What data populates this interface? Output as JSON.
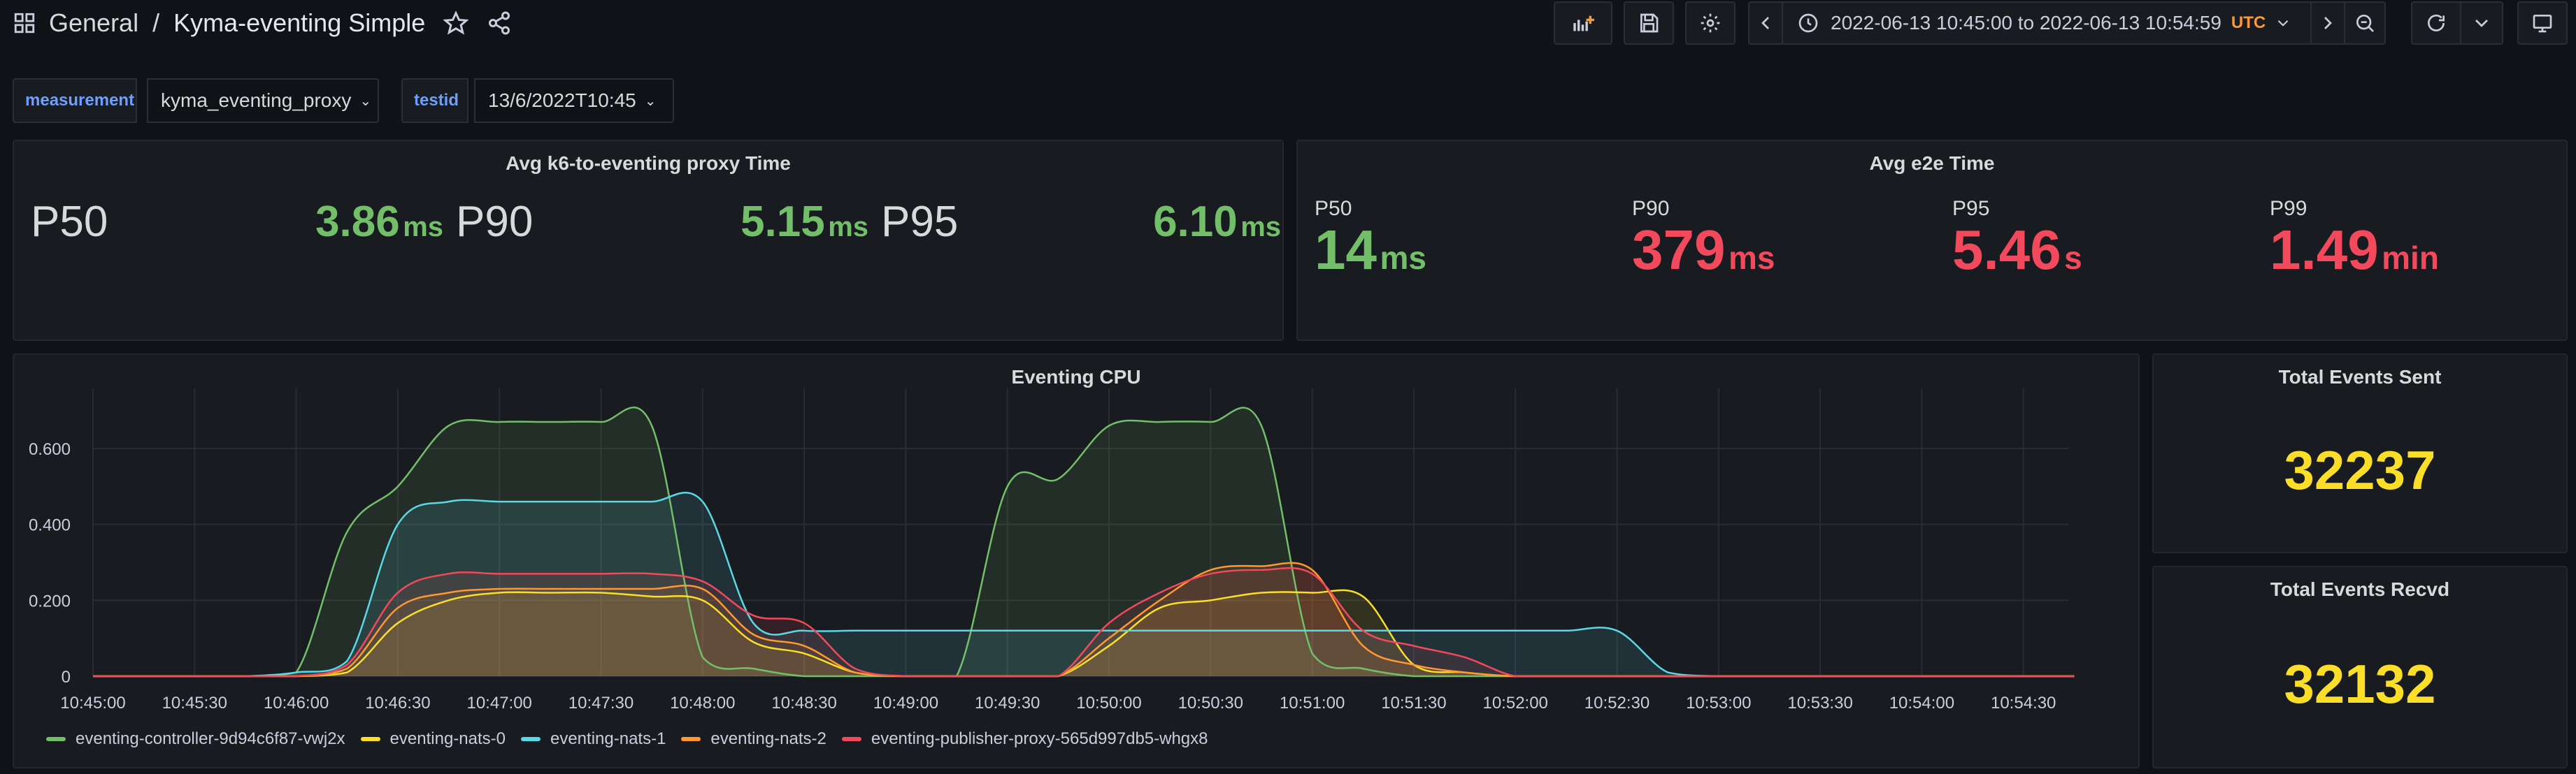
{
  "header": {
    "folder": "General",
    "separator": "/",
    "title": "Kyma-eventing Simple",
    "time_from": "2022-06-13 10:45:00",
    "time_to_word": "to",
    "time_to": "2022-06-13 10:54:59",
    "timezone": "UTC"
  },
  "variables": [
    {
      "label": "measurement",
      "value": "kyma_eventing_proxy"
    },
    {
      "label": "testid",
      "value": "13/6/2022T10:45"
    }
  ],
  "panels": {
    "proxy": {
      "title": "Avg k6-to-eventing proxy Time",
      "stats": [
        {
          "name": "P50",
          "value": "3.86",
          "unit": "ms"
        },
        {
          "name": "P90",
          "value": "5.15",
          "unit": "ms"
        },
        {
          "name": "P95",
          "value": "6.10",
          "unit": "ms"
        }
      ]
    },
    "e2e": {
      "title": "Avg e2e Time",
      "stats": [
        {
          "name": "P50",
          "value": "14",
          "unit": "ms",
          "color": "#73bf69"
        },
        {
          "name": "P90",
          "value": "379",
          "unit": "ms",
          "color": "#f2495c"
        },
        {
          "name": "P95",
          "value": "5.46",
          "unit": "s",
          "color": "#f2495c"
        },
        {
          "name": "P99",
          "value": "1.49",
          "unit": "min",
          "color": "#f2495c"
        }
      ]
    },
    "cpu": {
      "title": "Eventing CPU"
    },
    "sent": {
      "title": "Total Events Sent",
      "value": "32237"
    },
    "recvd": {
      "title": "Total Events Recvd",
      "value": "32132"
    }
  },
  "chart_data": {
    "type": "area",
    "title": "Eventing CPU",
    "x": [
      "10:45:00",
      "10:45:15",
      "10:45:30",
      "10:45:45",
      "10:46:00",
      "10:46:15",
      "10:46:30",
      "10:46:45",
      "10:47:00",
      "10:47:15",
      "10:47:30",
      "10:47:45",
      "10:48:00",
      "10:48:15",
      "10:48:30",
      "10:48:45",
      "10:49:00",
      "10:49:15",
      "10:49:30",
      "10:49:45",
      "10:50:00",
      "10:50:15",
      "10:50:30",
      "10:50:45",
      "10:51:00",
      "10:51:15",
      "10:51:30",
      "10:51:45",
      "10:52:00",
      "10:52:15",
      "10:52:30",
      "10:52:45",
      "10:53:00",
      "10:53:15",
      "10:53:30",
      "10:53:45",
      "10:54:00",
      "10:54:15",
      "10:54:30",
      "10:54:45"
    ],
    "x_ticks": [
      "10:45:00",
      "10:45:30",
      "10:46:00",
      "10:46:30",
      "10:47:00",
      "10:47:30",
      "10:48:00",
      "10:48:30",
      "10:49:00",
      "10:49:30",
      "10:50:00",
      "10:50:30",
      "10:51:00",
      "10:51:30",
      "10:52:00",
      "10:52:30",
      "10:53:00",
      "10:53:30",
      "10:54:00",
      "10:54:30"
    ],
    "y_ticks": [
      "0",
      "0.200",
      "0.400",
      "0.600"
    ],
    "ylim": [
      0,
      0.74
    ],
    "grid": true,
    "legend_position": "bottom-left",
    "series": [
      {
        "name": "eventing-controller-9d94c6f87-vwj2x",
        "color": "#73bf69",
        "values": [
          0,
          0,
          0,
          0,
          0.01,
          0.38,
          0.5,
          0.66,
          0.67,
          0.67,
          0.67,
          0.66,
          0.05,
          0.02,
          0,
          0,
          0,
          0,
          0.5,
          0.52,
          0.66,
          0.67,
          0.67,
          0.66,
          0.06,
          0.02,
          0,
          0,
          0,
          0,
          0,
          0,
          0,
          0,
          0,
          0,
          0,
          0,
          0,
          0
        ]
      },
      {
        "name": "eventing-nats-0",
        "color": "#fade2a",
        "values": [
          0,
          0,
          0,
          0,
          0,
          0.01,
          0.14,
          0.2,
          0.22,
          0.22,
          0.22,
          0.21,
          0.2,
          0.09,
          0.06,
          0.01,
          0,
          0,
          0,
          0,
          0.08,
          0.18,
          0.2,
          0.22,
          0.22,
          0.21,
          0.03,
          0.01,
          0,
          0,
          0,
          0,
          0,
          0,
          0,
          0,
          0,
          0,
          0,
          0
        ]
      },
      {
        "name": "eventing-nats-1",
        "color": "#5ad8e6",
        "values": [
          0,
          0,
          0,
          0,
          0.01,
          0.04,
          0.4,
          0.46,
          0.46,
          0.46,
          0.46,
          0.46,
          0.46,
          0.14,
          0.12,
          0.12,
          0.12,
          0.12,
          0.12,
          0.12,
          0.12,
          0.12,
          0.12,
          0.12,
          0.12,
          0.12,
          0.12,
          0.12,
          0.12,
          0.12,
          0.12,
          0.01,
          0,
          0,
          0,
          0,
          0,
          0,
          0,
          0
        ]
      },
      {
        "name": "eventing-nats-2",
        "color": "#ff9830",
        "values": [
          0,
          0,
          0,
          0,
          0,
          0.02,
          0.18,
          0.22,
          0.23,
          0.23,
          0.23,
          0.23,
          0.23,
          0.11,
          0.08,
          0.01,
          0,
          0,
          0,
          0,
          0.1,
          0.2,
          0.28,
          0.29,
          0.28,
          0.08,
          0.03,
          0.01,
          0,
          0,
          0,
          0,
          0,
          0,
          0,
          0,
          0,
          0,
          0,
          0
        ]
      },
      {
        "name": "eventing-publisher-proxy-565d997db5-whgx8",
        "color": "#f2495c",
        "values": [
          0,
          0,
          0,
          0,
          0,
          0.03,
          0.22,
          0.27,
          0.27,
          0.27,
          0.27,
          0.27,
          0.25,
          0.16,
          0.14,
          0.02,
          0,
          0,
          0,
          0,
          0.14,
          0.22,
          0.27,
          0.28,
          0.27,
          0.12,
          0.08,
          0.05,
          0,
          0,
          0,
          0,
          0,
          0,
          0,
          0,
          0,
          0,
          0,
          0
        ]
      }
    ]
  }
}
